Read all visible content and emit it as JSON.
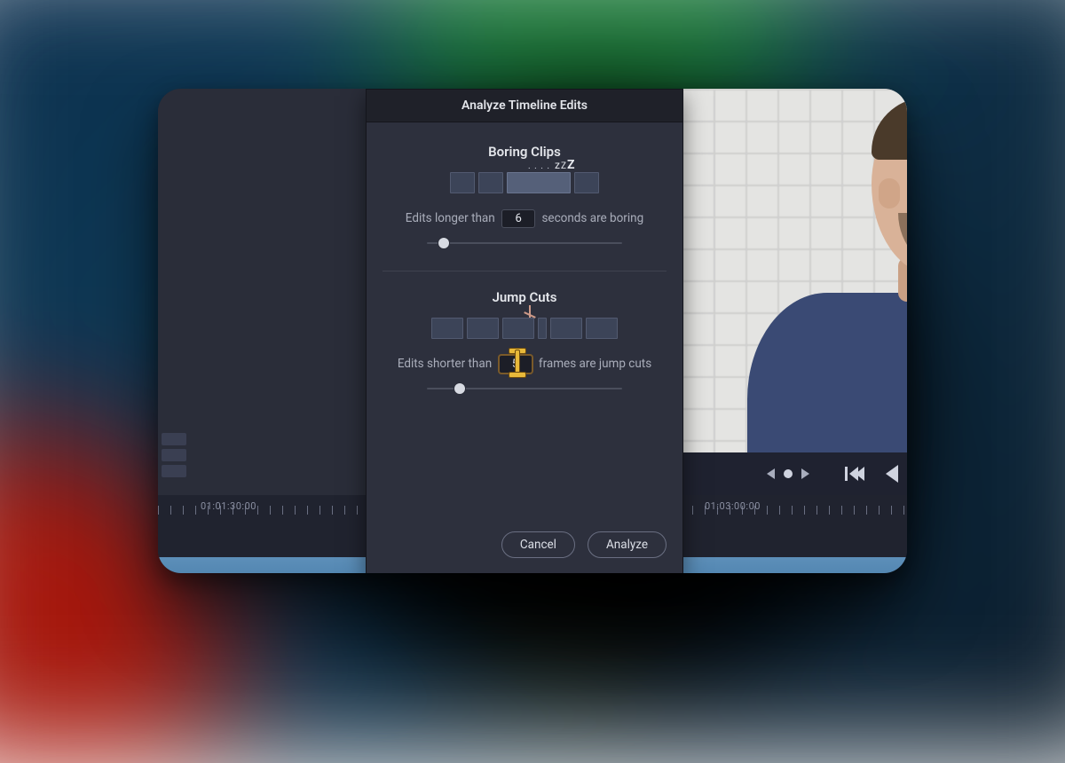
{
  "dialog": {
    "title": "Analyze Timeline Edits",
    "boring": {
      "heading": "Boring Clips",
      "prefix": "Edits longer than",
      "value": "6",
      "suffix": "seconds are boring",
      "slider_pos_pct": 6
    },
    "jump": {
      "heading": "Jump Cuts",
      "prefix": "Edits shorter than",
      "value": "5",
      "suffix": "frames are jump cuts",
      "slider_pos_pct": 14
    },
    "buttons": {
      "cancel": "Cancel",
      "analyze": "Analyze"
    }
  },
  "timeline": {
    "label_left": "01:01:30:00",
    "label_right": "01:03:00:00"
  }
}
